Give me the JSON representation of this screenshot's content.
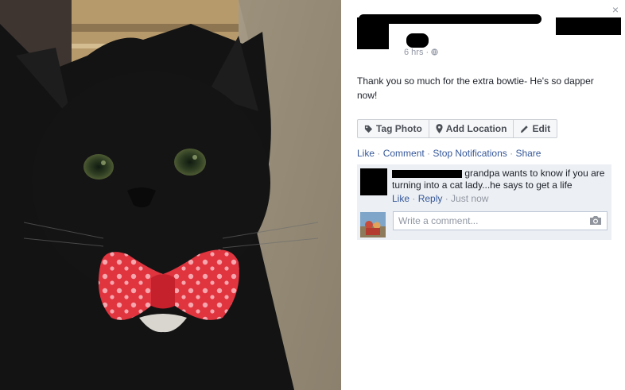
{
  "close_glyph": "×",
  "post": {
    "time": "6 hrs",
    "separator": "·",
    "privacy_icon": "globe-icon",
    "text": "Thank you so much for the extra bowtie- He's so dapper now!"
  },
  "buttons": {
    "tag_photo": "Tag Photo",
    "add_location": "Add Location",
    "edit": "Edit"
  },
  "actions": {
    "like": "Like",
    "comment": "Comment",
    "stop_notifications": "Stop Notifications",
    "share": "Share",
    "sep": " · "
  },
  "comment": {
    "text": "grandpa wants to know if you are turning into a cat lady...he says to get a life",
    "like": "Like",
    "reply": "Reply",
    "time": "Just now",
    "sep": " · "
  },
  "comment_input": {
    "placeholder": "Write a comment..."
  },
  "colors": {
    "link": "#365899",
    "muted": "#9197a3",
    "bowtie": "#e0343f"
  }
}
